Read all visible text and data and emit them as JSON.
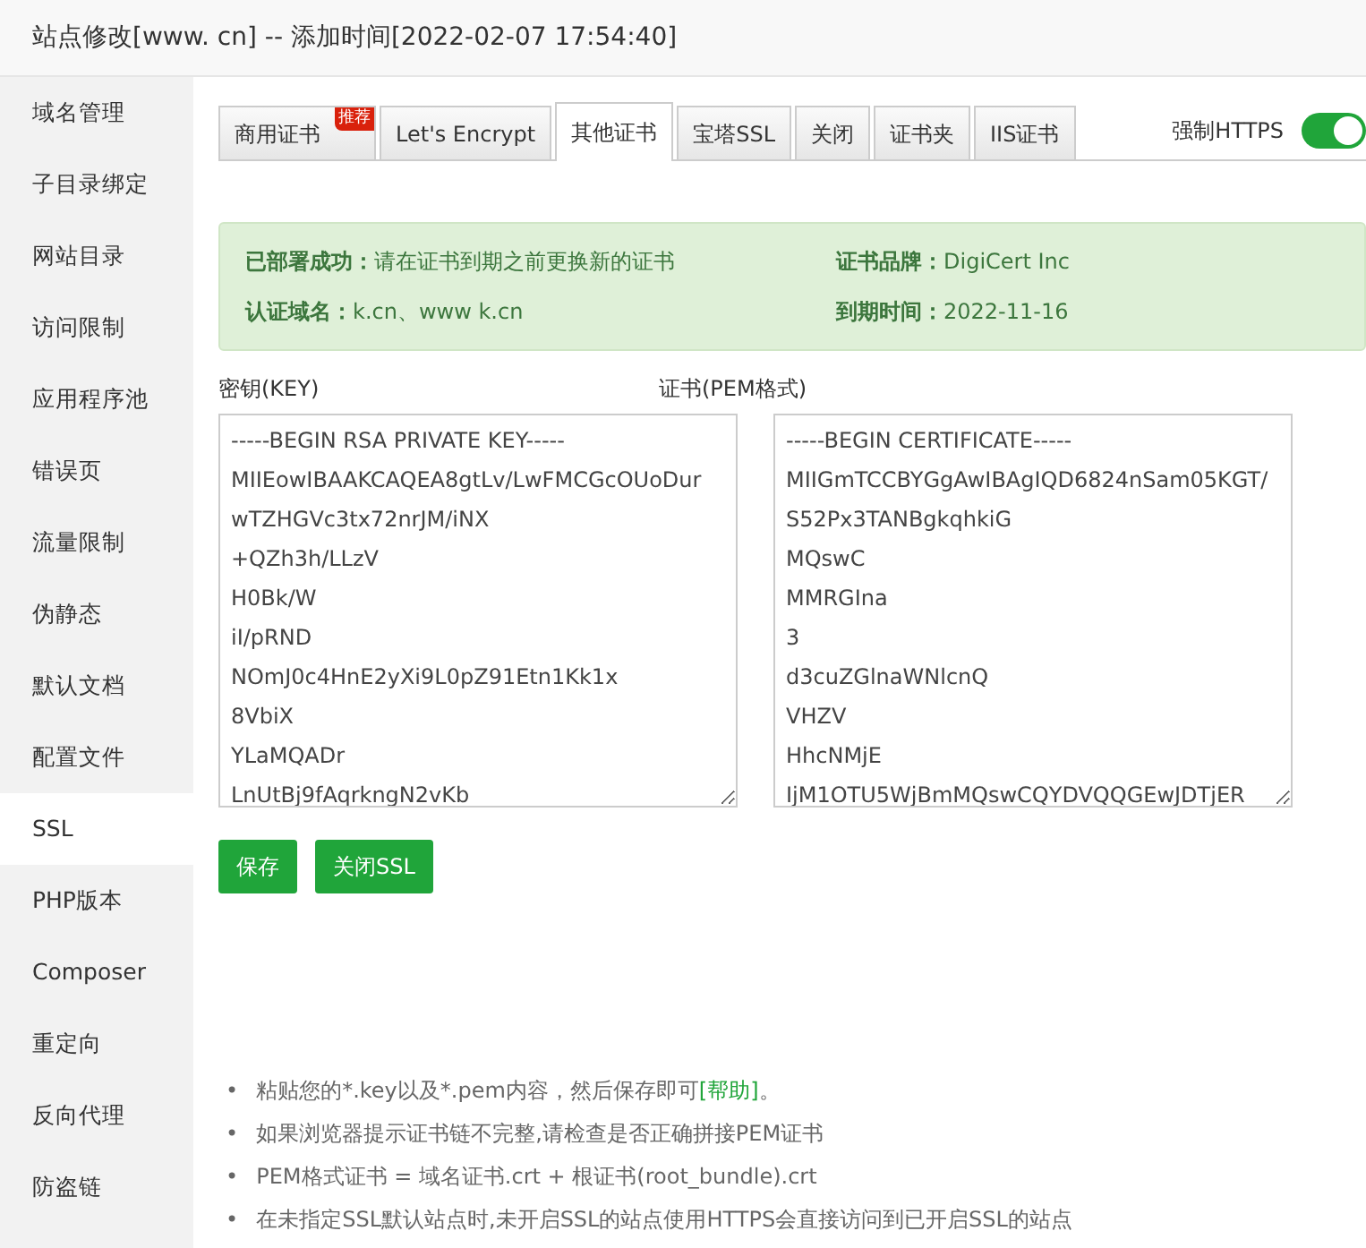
{
  "window": {
    "title": "站点修改[www.      cn] -- 添加时间[2022-02-07 17:54:40]"
  },
  "sidebar": {
    "items": [
      {
        "label": "域名管理",
        "selected": false
      },
      {
        "label": "子目录绑定",
        "selected": false
      },
      {
        "label": "网站目录",
        "selected": false
      },
      {
        "label": "访问限制",
        "selected": false
      },
      {
        "label": "应用程序池",
        "selected": false
      },
      {
        "label": "错误页",
        "selected": false
      },
      {
        "label": "流量限制",
        "selected": false
      },
      {
        "label": "伪静态",
        "selected": false
      },
      {
        "label": "默认文档",
        "selected": false
      },
      {
        "label": "配置文件",
        "selected": false
      },
      {
        "label": "SSL",
        "selected": true
      },
      {
        "label": "PHP版本",
        "selected": false
      },
      {
        "label": "Composer",
        "selected": false
      },
      {
        "label": "重定向",
        "selected": false
      },
      {
        "label": "反向代理",
        "selected": false
      },
      {
        "label": "防盗链",
        "selected": false
      }
    ]
  },
  "tabs": [
    {
      "label": "商用证书",
      "selected": false,
      "ribbon": "推荐"
    },
    {
      "label": "Let's Encrypt",
      "selected": false
    },
    {
      "label": "其他证书",
      "selected": true
    },
    {
      "label": "宝塔SSL",
      "selected": false
    },
    {
      "label": "关闭",
      "selected": false
    },
    {
      "label": "证书夹",
      "selected": false
    },
    {
      "label": "IIS证书",
      "selected": false
    }
  ],
  "force_https": {
    "label": "强制HTTPS",
    "on": true
  },
  "status": {
    "deployed_label": "已部署成功：",
    "deployed_text": "请在证书到期之前更换新的证书",
    "brand_label": "证书品牌：",
    "brand": "DigiCert Inc",
    "domains_label": "认证域名：",
    "domains": "k.cn、www      k.cn",
    "expiry_label": "到期时间：",
    "expiry": "2022-11-16"
  },
  "key": {
    "label": "密钥(KEY)",
    "lines": [
      "-----BEGIN RSA PRIVATE KEY-----",
      "MIIEowIBAAKCAQEA8gtLv/LwFMCGcOUoDur",
      "wTZHGVc3tx72nrJM/iNX",
      "+QZh3h/LLzV",
      "H0Bk/W",
      "iI/pRND",
      "NOmJ0c4HnE2yXi9L0pZ91Etn1Kk1x",
      "8VbiX",
      "YLaMQADr",
      "LnUtBj9fAqrkngN2vKb"
    ]
  },
  "certificate": {
    "label": "证书(PEM格式)",
    "lines": [
      "-----BEGIN CERTIFICATE-----",
      "MIIGmTCCBYGgAwIBAgIQD6824nSam05KGT/",
      "S52Px3TANBgkqhkiG",
      "MQswC",
      "MMRGIna",
      "3",
      "d3cuZGlnaWNlcnQ",
      "VHZV",
      "HhcNMjE",
      "IjM1OTU5WjBmMQswCQYDVQQGEwJDTjER"
    ]
  },
  "buttons": [
    {
      "label": "保存"
    },
    {
      "label": "关闭SSL"
    }
  ],
  "notes": [
    {
      "marker": "•",
      "text": "粘贴您的*.key以及*.pem内容，然后保存即可",
      "link": "[帮助]",
      "suffix": "。"
    },
    {
      "marker": "•",
      "text": "如果浏览器提示证书链不完整,请检查是否正确拼接PEM证书"
    },
    {
      "marker": "•",
      "text": "PEM格式证书 = 域名证书.crt + 根证书(root_bundle).crt"
    },
    {
      "marker": "•",
      "text": "在未指定SSL默认站点时,未开启SSL的站点使用HTTPS会直接访问到已开启SSL的站点"
    }
  ]
}
